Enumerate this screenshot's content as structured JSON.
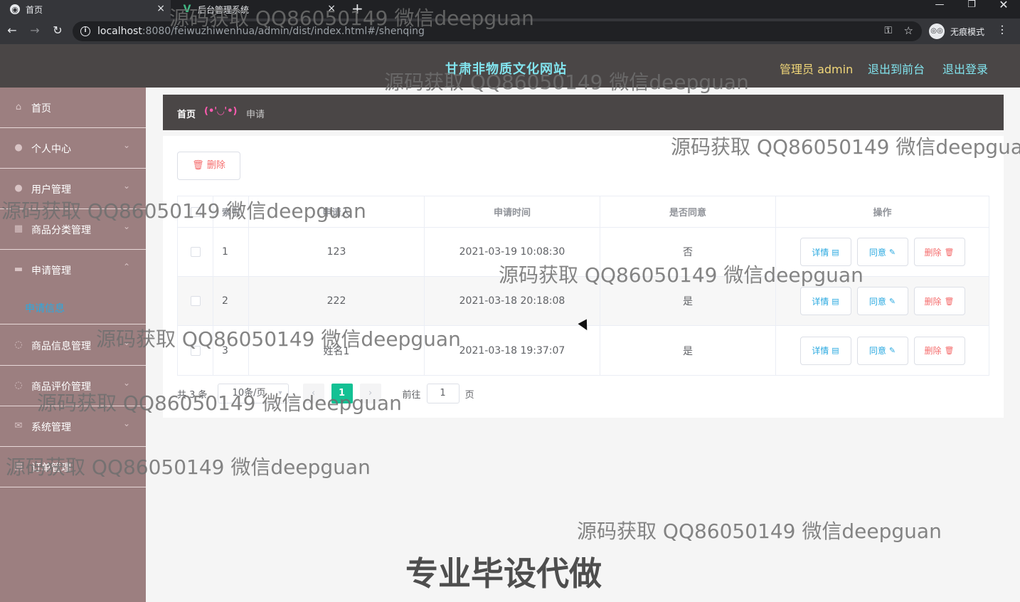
{
  "browser": {
    "tabs": [
      {
        "title": "首页",
        "favicon": "globe-icon"
      },
      {
        "title": "后台管理系统",
        "favicon": "vue-logo-icon"
      }
    ],
    "tab_close": "×",
    "new_tab": "+",
    "url_host": "localhost",
    "url_rest": ":8080/feiwuzhiwenhua/admin/dist/index.html#/shenqing",
    "incognito_label": "无痕模式",
    "window_min": "—",
    "window_max": "❐",
    "window_close": "✕"
  },
  "header": {
    "site_title": "甘肃非物质文化网站",
    "admin_label": "管理员 admin",
    "front_link": "退出到前台",
    "logout_link": "退出登录",
    "title_color": "#82e4ee",
    "admin_color": "#f1d779"
  },
  "sidebar": {
    "items": [
      {
        "label": "首页",
        "icon": "home-icon",
        "arrow": ""
      },
      {
        "label": "个人中心",
        "icon": "user-icon",
        "arrow": "⌄"
      },
      {
        "label": "用户管理",
        "icon": "users-icon",
        "arrow": "⌄"
      },
      {
        "label": "商品分类管理",
        "icon": "category-icon",
        "arrow": "⌄"
      },
      {
        "label": "申请管理",
        "icon": "folder-icon",
        "arrow": "⌃"
      },
      {
        "label": "商品信息管理",
        "icon": "info-icon",
        "arrow": "⌄"
      },
      {
        "label": "商品评价管理",
        "icon": "comment-icon",
        "arrow": "⌄"
      },
      {
        "label": "系统管理",
        "icon": "mail-icon",
        "arrow": "⌄"
      },
      {
        "label": "订单管理",
        "icon": "order-icon",
        "arrow": ""
      }
    ],
    "submenu_active": "申请信息"
  },
  "breadcrumb": {
    "home": "首页",
    "separator": "(•'◡'•)",
    "current": "申请"
  },
  "toolbar": {
    "delete_label": "删除"
  },
  "table": {
    "columns": [
      "",
      "索引",
      "申请人",
      "申请时间",
      "是否同意",
      "操作"
    ],
    "rows": [
      {
        "index": "1",
        "applicant": "123",
        "time": "2021-03-19 10:08:30",
        "agree": "否"
      },
      {
        "index": "2",
        "applicant": "222",
        "time": "2021-03-18 20:18:08",
        "agree": "是"
      },
      {
        "index": "3",
        "applicant": "姓名1",
        "time": "2021-03-18 19:37:07",
        "agree": "是"
      }
    ],
    "btn_detail": "详情",
    "btn_agree": "同意",
    "btn_delete": "删除"
  },
  "pagination": {
    "total": "共 3 条",
    "page_size": "10条/页",
    "prev": "‹",
    "current_page": "1",
    "next": "›",
    "goto_label": "前往",
    "goto_value": "1",
    "page_suffix": "页"
  },
  "watermarks": {
    "line": "源码获取 QQ86050149 微信deepguan",
    "banner": "专业毕设代做"
  },
  "colors": {
    "header_bg": "#4a4646",
    "sidebar_bg": "#9c7f80",
    "accent_green": "#13c194",
    "link_blue": "#2aa9e0",
    "danger_red": "#f56c6c"
  }
}
